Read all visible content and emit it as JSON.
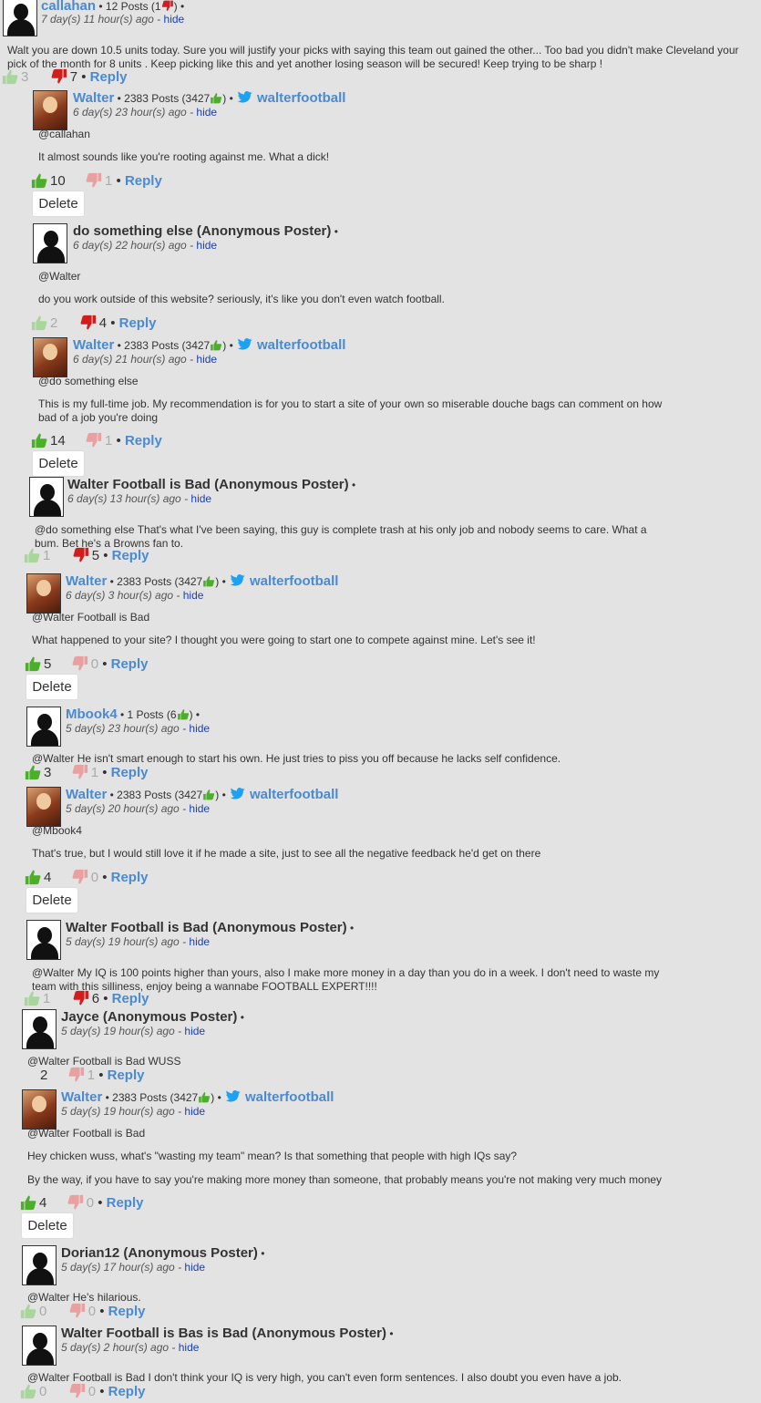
{
  "comments": [
    {
      "author": "callahan",
      "meta": " • 12 Posts (1",
      "meta2": ") •",
      "ago": "7 day(s) 11 hour(s) ago",
      "hide": "hide",
      "text": "Walt you are down 10.5 units today. Sure you will justify your picks with saying this team out gained the other... Too bad you didn't make Cleveland your pick of the month for 8 units . Keep picking like this and yet another losing season will be secured! Keep trying to be sharp !",
      "up": "3",
      "down": "7",
      "reply": "Reply"
    },
    {
      "author": "Walter",
      "meta": " • 2383 Posts (3427",
      "meta2": ") •",
      "twitter": "walterfootball",
      "ago": "6 day(s) 23 hour(s) ago",
      "hide": "hide",
      "p1": "@callahan",
      "p2": "It almost sounds like you're rooting against me. What a dick!",
      "up": "10",
      "down": "1",
      "reply": "Reply",
      "delete": "Delete"
    },
    {
      "author": "do something else (Anonymous Poster)",
      "meta2": " •",
      "ago": "6 day(s) 22 hour(s) ago",
      "hide": "hide",
      "p1": "@Walter",
      "p2": "do you work outside of this website?  seriously, it's like you don't even watch football.",
      "up": "2",
      "down": "4",
      "reply": "Reply"
    },
    {
      "author": "Walter",
      "meta": " • 2383 Posts (3427",
      "meta2": ") •",
      "twitter": "walterfootball",
      "ago": "6 day(s) 21 hour(s) ago",
      "hide": "hide",
      "p1": "@do something else",
      "p2": "This is my full-time job. My recommendation is for you to start a site of your own so miserable douche bags can comment on how bad of a job you're doing",
      "up": "14",
      "down": "1",
      "reply": "Reply",
      "delete": "Delete"
    },
    {
      "author": "Walter Football is Bad (Anonymous Poster)",
      "meta2": " •",
      "ago": "6 day(s) 13 hour(s) ago",
      "hide": "hide",
      "p1": "@do something else  That's what I've been saying, this guy is complete trash at his only job and nobody seems to care. What a bum. Bet he's a Browns fan to.",
      "up": "1",
      "down": "5",
      "reply": "Reply"
    },
    {
      "author": "Walter",
      "meta": " • 2383 Posts (3427",
      "meta2": ") •",
      "twitter": "walterfootball",
      "ago": "6 day(s) 3 hour(s) ago",
      "hide": "hide",
      "p1": "@Walter Football is Bad",
      "p2": "What happened to your site? I thought you were going to start one to compete against mine. Let's see it!",
      "up": "5",
      "down": "0",
      "reply": "Reply",
      "delete": "Delete"
    },
    {
      "author": "Mbook4",
      "meta": " • 1 Posts (6",
      "meta2": ") •",
      "ago": "5 day(s) 23 hour(s) ago",
      "hide": "hide",
      "p1": "@Walter He isn't smart enough to start his own.  He just tries to piss you off because he lacks self confidence.",
      "up": "3",
      "down": "1",
      "reply": "Reply"
    },
    {
      "author": "Walter",
      "meta": " • 2383 Posts (3427",
      "meta2": ") •",
      "twitter": "walterfootball",
      "ago": "5 day(s) 20 hour(s) ago",
      "hide": "hide",
      "p1": "@Mbook4",
      "p2": "That's true, but I would still love it if he made a site, just to see all the negative feedback he'd get on there",
      "up": "4",
      "down": "0",
      "reply": "Reply",
      "delete": "Delete"
    },
    {
      "author": "Walter Football is Bad (Anonymous Poster)",
      "meta2": " •",
      "ago": "5 day(s) 19 hour(s) ago",
      "hide": "hide",
      "p1": "@Walter My IQ is 100 points higher than yours, also I make more money in a day than you do in a week. I don't need to waste my team with this silliness, enjoy being a wannabe FOOTBALL EXPERT!!!!",
      "up": "1",
      "down": "6",
      "reply": "Reply"
    },
    {
      "author": "Jayce (Anonymous Poster)",
      "meta2": " •",
      "ago": "5 day(s) 19 hour(s) ago",
      "hide": "hide",
      "p1": "@Walter Football is Bad WUSS",
      "up": "2",
      "down": "1",
      "reply": "Reply"
    },
    {
      "author": "Walter",
      "meta": " • 2383 Posts (3427",
      "meta2": ") •",
      "twitter": "walterfootball",
      "ago": "5 day(s) 19 hour(s) ago",
      "hide": "hide",
      "p1": "@Walter Football is Bad",
      "p2": "Hey chicken wuss, what's \"wasting my team\" mean? Is that something that people with high IQs say?",
      "p3": "By the way, if you have to say you're making more money than someone, that probably means you're not making very much money",
      "up": "4",
      "down": "0",
      "reply": "Reply",
      "delete": "Delete"
    },
    {
      "author": "Dorian12 (Anonymous Poster)",
      "meta2": " •",
      "ago": "5 day(s) 17 hour(s) ago",
      "hide": "hide",
      "p1": "@Walter He's hilarious.",
      "up": "0",
      "down": "0",
      "reply": "Reply"
    },
    {
      "author": "Walter Football is Bas is Bad (Anonymous Poster)",
      "meta2": " •",
      "ago": "5 day(s) 2 hour(s) ago",
      "hide": "hide",
      "p1": "@Walter Football is Bad I don't think your IQ is very high, you can't even form sentences. I also doubt you even have a job.",
      "up": "0",
      "down": "0",
      "reply": "Reply"
    }
  ],
  "colors": {
    "link": "#4a8ad0",
    "hide_link": "#1a3fb5",
    "thumb_up": "#4caf2a",
    "thumb_down": "#d01e1e",
    "background": "#e3e3e3"
  }
}
